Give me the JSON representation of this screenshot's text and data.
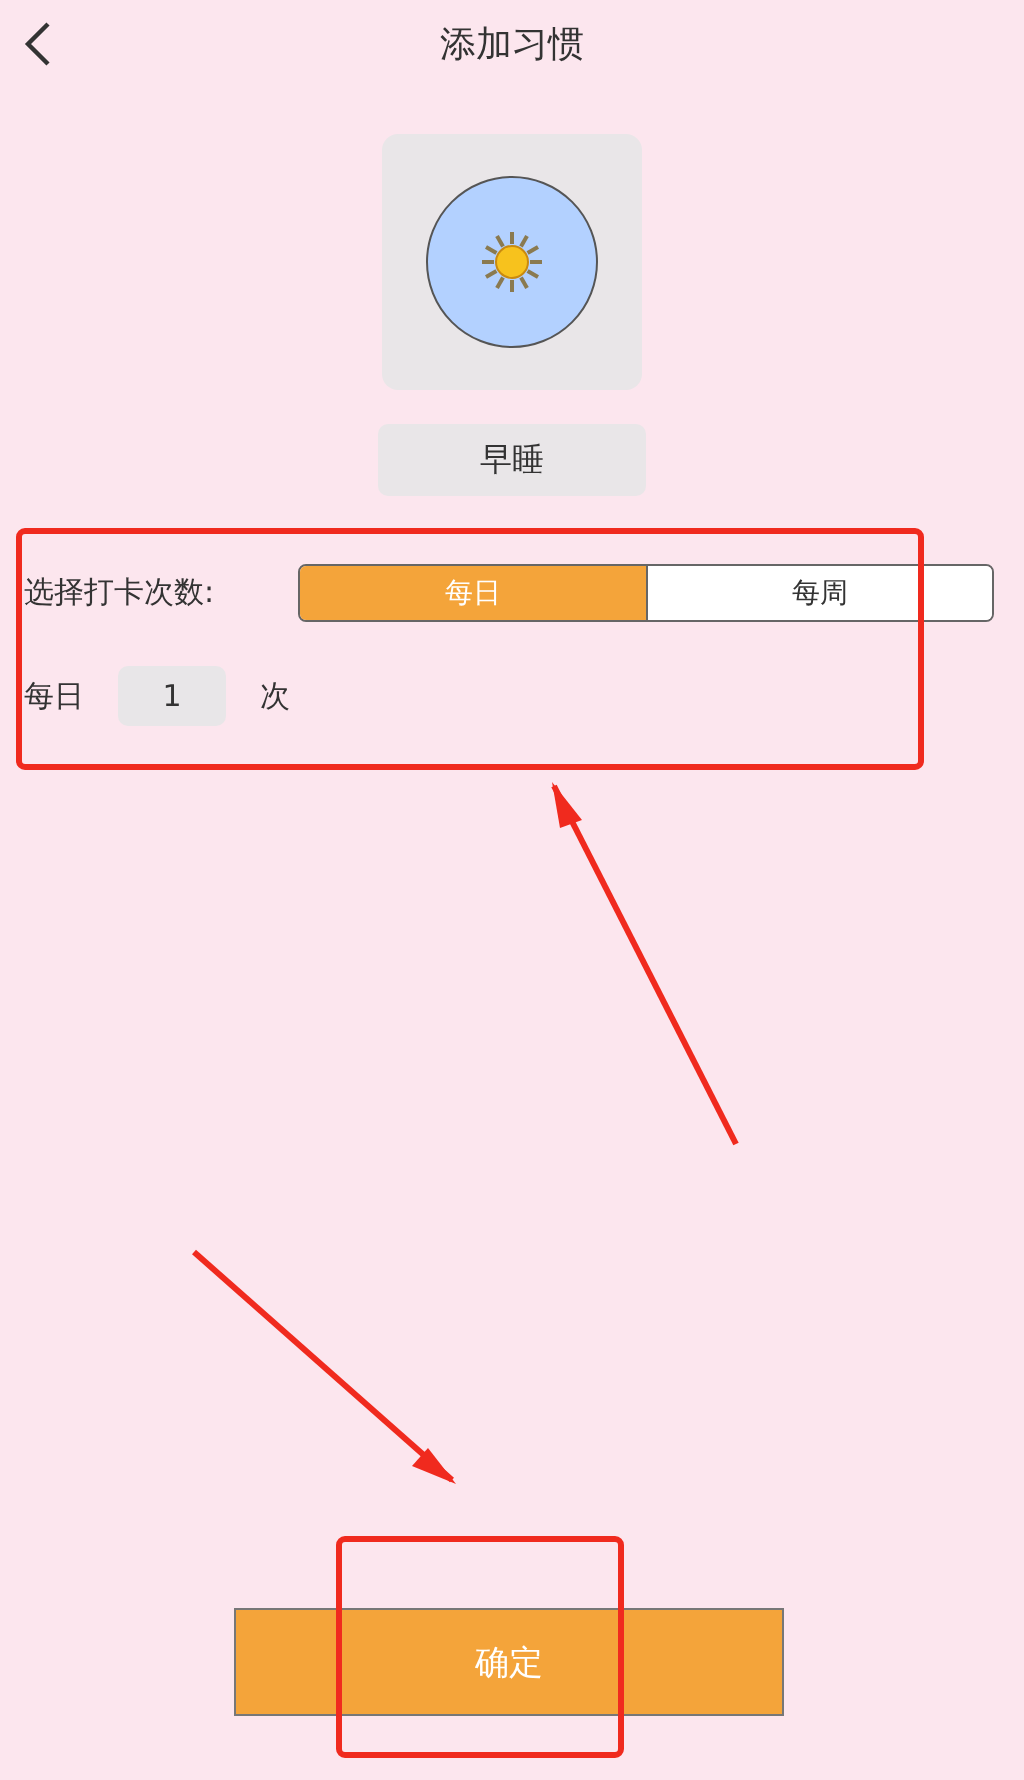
{
  "header": {
    "title": "添加习惯"
  },
  "habit": {
    "name": "早睡"
  },
  "frequency": {
    "label": "选择打卡次数:",
    "options": [
      {
        "label": "每日",
        "selected": true
      },
      {
        "label": "每周",
        "selected": false
      }
    ]
  },
  "count": {
    "prefix": "每日",
    "value": "1",
    "suffix": "次"
  },
  "confirm_button": "确定"
}
